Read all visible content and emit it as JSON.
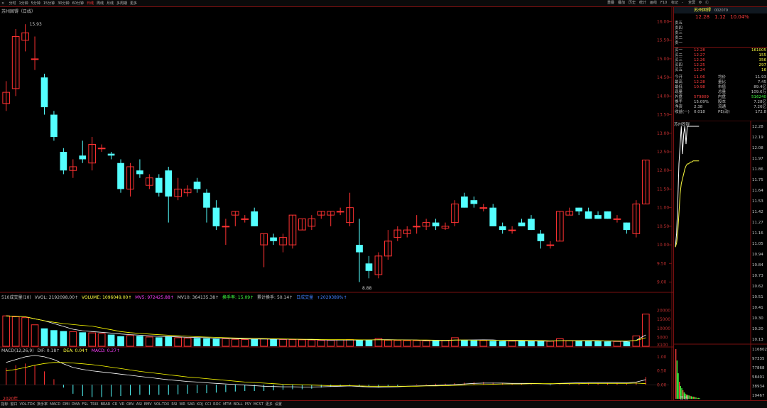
{
  "toolbar": {
    "periods": [
      "分时",
      "1分钟",
      "5分钟",
      "15分钟",
      "30分钟",
      "60分钟",
      "日线",
      "周线",
      "月线",
      "多周期",
      "更多"
    ],
    "active_index": 6,
    "right_items": [
      "重叠",
      "叠加",
      "历史",
      "统计",
      "画线",
      "F10",
      "标记",
      "-",
      "全屏",
      "Φ",
      "Ⓒ"
    ]
  },
  "stock": {
    "name": "苏州固锝",
    "code": "002079",
    "chart_title": "苏州固锝（日线）",
    "price": "12.28",
    "change": "1.12",
    "change_pct": "10.04%"
  },
  "colors": {
    "up": "#ff3232",
    "down": "#54ffff",
    "ma_white": "#ffffff",
    "ma_yellow": "#ffff00",
    "ma_magenta": "#ff40ff",
    "ma_green": "#00ff00",
    "grid_red": "#7a1010"
  },
  "icons": {
    "close_window": "close-icon",
    "refresh": "refresh-icon"
  },
  "chart_data": [
    {
      "type": "candlestick",
      "title": "苏州固锝（日线）",
      "ylim": [
        8.8,
        16.2
      ],
      "y_ticks": [
        "16.00",
        "15.50",
        "15.00",
        "14.50",
        "14.00",
        "13.50",
        "13.00",
        "12.50",
        "12.00",
        "11.50",
        "11.00",
        "10.50",
        "10.00",
        "9.50",
        "9.00"
      ],
      "annotations": {
        "high": "15.93",
        "low": "8.88"
      },
      "candles": [
        {
          "o": 13.8,
          "h": 14.4,
          "l": 13.6,
          "c": 14.1
        },
        {
          "o": 14.2,
          "h": 15.8,
          "l": 14.0,
          "c": 15.6
        },
        {
          "o": 15.5,
          "h": 15.93,
          "l": 15.2,
          "c": 15.7
        },
        {
          "o": 15.0,
          "h": 15.6,
          "l": 14.7,
          "c": 15.0
        },
        {
          "o": 14.5,
          "h": 14.6,
          "l": 13.5,
          "c": 13.7
        },
        {
          "o": 13.5,
          "h": 13.6,
          "l": 12.8,
          "c": 12.9
        },
        {
          "o": 12.5,
          "h": 12.6,
          "l": 11.9,
          "c": 12.0
        },
        {
          "o": 12.0,
          "h": 12.3,
          "l": 11.8,
          "c": 12.1
        },
        {
          "o": 12.4,
          "h": 12.8,
          "l": 12.2,
          "c": 12.3
        },
        {
          "o": 12.2,
          "h": 12.9,
          "l": 12.0,
          "c": 12.7
        },
        {
          "o": 12.6,
          "h": 12.7,
          "l": 12.5,
          "c": 12.6
        },
        {
          "o": 12.45,
          "h": 12.5,
          "l": 12.3,
          "c": 12.4
        },
        {
          "o": 12.2,
          "h": 12.3,
          "l": 11.4,
          "c": 11.5
        },
        {
          "o": 11.5,
          "h": 12.2,
          "l": 11.3,
          "c": 12.1
        },
        {
          "o": 12.0,
          "h": 12.3,
          "l": 11.8,
          "c": 11.9
        },
        {
          "o": 11.6,
          "h": 11.9,
          "l": 11.5,
          "c": 11.8
        },
        {
          "o": 11.8,
          "h": 11.9,
          "l": 11.3,
          "c": 11.4
        },
        {
          "o": 12.0,
          "h": 12.1,
          "l": 10.6,
          "c": 11.3
        },
        {
          "o": 11.3,
          "h": 11.8,
          "l": 11.2,
          "c": 11.5
        },
        {
          "o": 11.4,
          "h": 11.6,
          "l": 11.3,
          "c": 11.5
        },
        {
          "o": 11.7,
          "h": 11.8,
          "l": 11.4,
          "c": 11.5
        },
        {
          "o": 11.4,
          "h": 11.5,
          "l": 10.6,
          "c": 11.0
        },
        {
          "o": 11.0,
          "h": 11.2,
          "l": 10.4,
          "c": 10.5
        },
        {
          "o": 10.5,
          "h": 10.7,
          "l": 10.0,
          "c": 10.5
        },
        {
          "o": 10.8,
          "h": 10.9,
          "l": 10.5,
          "c": 10.9
        },
        {
          "o": 10.7,
          "h": 10.8,
          "l": 10.6,
          "c": 10.7
        },
        {
          "o": 10.9,
          "h": 11.0,
          "l": 10.5,
          "c": 10.5
        },
        {
          "o": 10.0,
          "h": 10.3,
          "l": 9.4,
          "c": 10.3
        },
        {
          "o": 10.2,
          "h": 10.3,
          "l": 10.0,
          "c": 10.1
        },
        {
          "o": 10.0,
          "h": 10.3,
          "l": 9.8,
          "c": 10.2
        },
        {
          "o": 10.0,
          "h": 10.8,
          "l": 9.9,
          "c": 10.8
        },
        {
          "o": 10.4,
          "h": 10.7,
          "l": 10.4,
          "c": 10.7
        },
        {
          "o": 10.5,
          "h": 10.8,
          "l": 10.4,
          "c": 10.7
        },
        {
          "o": 10.8,
          "h": 10.9,
          "l": 10.7,
          "c": 10.9
        },
        {
          "o": 10.8,
          "h": 10.9,
          "l": 10.5,
          "c": 10.9
        },
        {
          "o": 10.9,
          "h": 11.0,
          "l": 10.8,
          "c": 10.9
        },
        {
          "o": 10.6,
          "h": 11.4,
          "l": 10.5,
          "c": 11.0
        },
        {
          "o": 10.0,
          "h": 10.7,
          "l": 9.0,
          "c": 9.8
        },
        {
          "o": 9.5,
          "h": 9.7,
          "l": 9.1,
          "c": 9.3
        },
        {
          "o": 9.2,
          "h": 9.8,
          "l": 9.1,
          "c": 9.7
        },
        {
          "o": 9.7,
          "h": 10.4,
          "l": 9.6,
          "c": 10.1
        },
        {
          "o": 10.2,
          "h": 10.5,
          "l": 10.1,
          "c": 10.4
        },
        {
          "o": 10.3,
          "h": 10.5,
          "l": 10.2,
          "c": 10.4
        },
        {
          "o": 10.5,
          "h": 10.8,
          "l": 10.3,
          "c": 10.5
        },
        {
          "o": 10.5,
          "h": 10.7,
          "l": 10.4,
          "c": 10.6
        },
        {
          "o": 10.6,
          "h": 10.7,
          "l": 10.4,
          "c": 10.5
        },
        {
          "o": 10.45,
          "h": 10.6,
          "l": 10.4,
          "c": 10.5
        },
        {
          "o": 10.6,
          "h": 11.2,
          "l": 10.5,
          "c": 11.1
        },
        {
          "o": 11.3,
          "h": 11.4,
          "l": 11.0,
          "c": 11.0
        },
        {
          "o": 11.2,
          "h": 11.3,
          "l": 11.0,
          "c": 11.1
        },
        {
          "o": 11.0,
          "h": 11.1,
          "l": 10.9,
          "c": 11.0
        },
        {
          "o": 11.0,
          "h": 11.1,
          "l": 10.5,
          "c": 10.5
        },
        {
          "o": 10.5,
          "h": 10.6,
          "l": 10.3,
          "c": 10.4
        },
        {
          "o": 10.4,
          "h": 10.5,
          "l": 10.3,
          "c": 10.4
        },
        {
          "o": 10.6,
          "h": 10.7,
          "l": 10.5,
          "c": 10.5
        },
        {
          "o": 10.7,
          "h": 10.8,
          "l": 10.4,
          "c": 10.4
        },
        {
          "o": 10.3,
          "h": 10.4,
          "l": 9.9,
          "c": 10.1
        },
        {
          "o": 10.0,
          "h": 10.1,
          "l": 9.9,
          "c": 10.0
        },
        {
          "o": 10.1,
          "h": 10.9,
          "l": 10.1,
          "c": 10.9
        },
        {
          "o": 10.8,
          "h": 11.0,
          "l": 10.8,
          "c": 10.9
        },
        {
          "o": 11.0,
          "h": 11.0,
          "l": 10.8,
          "c": 10.9
        },
        {
          "o": 10.9,
          "h": 11.0,
          "l": 10.7,
          "c": 10.7
        },
        {
          "o": 10.8,
          "h": 10.9,
          "l": 10.7,
          "c": 10.7
        },
        {
          "o": 10.9,
          "h": 10.9,
          "l": 10.7,
          "c": 10.7
        },
        {
          "o": 10.7,
          "h": 10.8,
          "l": 10.6,
          "c": 10.7
        },
        {
          "o": 10.6,
          "h": 10.6,
          "l": 10.3,
          "c": 10.4
        },
        {
          "o": 10.3,
          "h": 11.2,
          "l": 10.2,
          "c": 11.1
        },
        {
          "o": 11.1,
          "h": 12.28,
          "l": 11.1,
          "c": 12.28
        }
      ]
    },
    {
      "type": "bar",
      "title": "成交量",
      "values": [
        17000,
        16500,
        16000,
        12000,
        10000,
        9000,
        8500,
        8200,
        7800,
        7500,
        7000,
        6500,
        5600,
        6000,
        5800,
        5200,
        5000,
        5400,
        4800,
        4600,
        4600,
        4400,
        4200,
        4200,
        3900,
        3800,
        4000,
        4200,
        4000,
        3800,
        3700,
        3600,
        3500,
        3300,
        3400,
        3600,
        3700,
        3500,
        3600,
        4300,
        3400,
        3300,
        3200,
        3200,
        3000,
        3100,
        3200,
        4800,
        3500,
        3300,
        3200,
        3000,
        2900,
        2900,
        3000,
        2900,
        2800,
        2800,
        4200,
        3100,
        3000,
        2900,
        2800,
        2700,
        2700,
        2600,
        5800,
        18000
      ],
      "ylim": [
        0,
        25000
      ],
      "y_ticks": [
        "20000",
        "15000",
        "10000",
        "5000",
        "X100"
      ]
    },
    {
      "type": "line",
      "title": "MACD",
      "ylim": [
        -0.5,
        1.2
      ],
      "y_ticks": [
        "1.00",
        "0.50",
        "0.00"
      ],
      "series": [
        {
          "name": "DIF",
          "values": [
            0.8,
            0.9,
            1.0,
            1.05,
            1.0,
            0.9,
            0.75,
            0.62,
            0.55,
            0.5,
            0.46,
            0.42,
            0.38,
            0.34,
            0.3,
            0.26,
            0.22,
            0.18,
            0.15,
            0.12,
            0.1,
            0.07,
            0.05,
            0.03,
            0.01,
            -0.01,
            -0.03,
            -0.05,
            -0.06,
            -0.07,
            -0.07,
            -0.08,
            -0.08,
            -0.07,
            -0.06,
            -0.05,
            -0.04,
            -0.06,
            -0.08,
            -0.09,
            -0.08,
            -0.07,
            -0.05,
            -0.04,
            -0.03,
            -0.02,
            -0.01,
            0.01,
            0.03,
            0.05,
            0.06,
            0.06,
            0.06,
            0.05,
            0.05,
            0.05,
            0.04,
            0.03,
            0.05,
            0.06,
            0.07,
            0.08,
            0.08,
            0.08,
            0.08,
            0.07,
            0.1,
            0.18
          ]
        },
        {
          "name": "DEA",
          "values": [
            0.5,
            0.55,
            0.62,
            0.7,
            0.76,
            0.8,
            0.8,
            0.78,
            0.75,
            0.72,
            0.68,
            0.63,
            0.58,
            0.53,
            0.48,
            0.44,
            0.4,
            0.36,
            0.32,
            0.28,
            0.25,
            0.22,
            0.19,
            0.16,
            0.13,
            0.1,
            0.08,
            0.06,
            0.04,
            0.02,
            0.01,
            0.0,
            -0.01,
            -0.02,
            -0.03,
            -0.03,
            -0.03,
            -0.04,
            -0.05,
            -0.05,
            -0.05,
            -0.05,
            -0.05,
            -0.05,
            -0.04,
            -0.04,
            -0.03,
            -0.02,
            -0.01,
            0.0,
            0.01,
            0.02,
            0.03,
            0.03,
            0.03,
            0.04,
            0.04,
            0.04,
            0.04,
            0.04,
            0.04,
            0.05,
            0.05,
            0.05,
            0.05,
            0.05,
            0.06,
            0.04
          ]
        }
      ]
    }
  ],
  "ma_labels": {
    "ma_title": "",
    "vol_label": "510成交量(10)",
    "vvol": "VVOL: 2192098.00↑",
    "volume": "VOLUME: 1096049.00↑",
    "mv5": "MV5: 972425.88↑",
    "mv10": "MV10: 364135.38↑",
    "turnover": "换手率: 15.09↑",
    "cum_turnover": "累计换手: 50.14↑",
    "extra": "日成交量",
    "extra2": "+2029389%↑",
    "macd_label": "MACD(12,26,9)",
    "dif": "DIF: 0.18↑",
    "dea": "DEA: 0.04↑",
    "macd": "MACD: 0.27↑",
    "year_label": "2020年"
  },
  "orderbook": {
    "sells": [
      {
        "label": "卖五",
        "price": "",
        "vol": ""
      },
      {
        "label": "卖四",
        "price": "",
        "vol": ""
      },
      {
        "label": "卖三",
        "price": "",
        "vol": ""
      },
      {
        "label": "卖二",
        "price": "",
        "vol": ""
      },
      {
        "label": "卖一",
        "price": "",
        "vol": ""
      }
    ],
    "buys": [
      {
        "label": "买一",
        "price": "12.28",
        "vol": "161005"
      },
      {
        "label": "买二",
        "price": "12.27",
        "vol": "155"
      },
      {
        "label": "买三",
        "price": "12.26",
        "vol": "356"
      },
      {
        "label": "买四",
        "price": "12.25",
        "vol": "297"
      },
      {
        "label": "买五",
        "price": "12.24",
        "vol": "16"
      }
    ]
  },
  "stats": [
    {
      "k1": "今开",
      "v1": "11.06",
      "k2": "均价",
      "v2": "11.93"
    },
    {
      "k1": "最高",
      "v1": "12.28",
      "k2": "量比",
      "v2": "7.45"
    },
    {
      "k1": "最低",
      "v1": "10.98",
      "k2": "市值",
      "v2": "89.4亿"
    },
    {
      "k1": "现量",
      "v1": "",
      "k2": "总量",
      "v2": "109.6万"
    },
    {
      "k1": "外盘",
      "v1": "579809",
      "k2": "内盘",
      "v2": "516240"
    },
    {
      "k1": "换手",
      "v1": "15.09%",
      "k2": "股本",
      "v2": "7.28亿"
    },
    {
      "k1": "净资",
      "v1": "2.38",
      "k2": "流通",
      "v2": "7.26亿"
    },
    {
      "k1": "收益(一)",
      "v1": "0.018",
      "k2": "PE(动)",
      "v2": "172.8"
    }
  ],
  "mini_chart": {
    "name": "苏州固锝",
    "price_ticks": [
      "12.28",
      "12.19",
      "12.08",
      "11.97",
      "11.86",
      "11.75",
      "11.64",
      "11.53",
      "11.42",
      "11.27",
      "11.16",
      "11.05",
      "10.94",
      "10.84",
      "10.73",
      "10.62",
      "10.51",
      "10.41",
      "10.30",
      "10.20",
      "10.13"
    ],
    "vol_ticks": [
      "116802",
      "97335",
      "77868",
      "58401",
      "38934",
      "19467"
    ],
    "bottom_label": "日线",
    "price_line": [
      11.06,
      11.2,
      11.5,
      11.9,
      12.1,
      12.28,
      12.0,
      12.2,
      12.28,
      12.1,
      12.28,
      12.28,
      12.28,
      12.28,
      12.28,
      12.28,
      12.28,
      12.28,
      12.28,
      12.28,
      12.28
    ],
    "avg_line": [
      11.06,
      11.1,
      11.2,
      11.4,
      11.6,
      11.7,
      11.75,
      11.8,
      11.85,
      11.88,
      11.9,
      11.9,
      11.91,
      11.92,
      11.92,
      11.93,
      11.93,
      11.93,
      11.93,
      11.93,
      11.93
    ],
    "volume": [
      116802,
      90000,
      60000,
      40000,
      30000,
      25000,
      20000,
      15000,
      12000,
      10000,
      9000,
      8000,
      7000,
      6000,
      5000,
      5000,
      4000,
      3000,
      2000,
      2000,
      1500
    ]
  },
  "bottom_tabs": [
    "指标",
    "窗口",
    "VOL-TDX",
    "换手率",
    "MACD",
    "DMI",
    "DMA",
    "FSL",
    "TRIX",
    "BRAR",
    "CR",
    "VR",
    "OBV",
    "ASI",
    "EMV",
    "VOL-TDX",
    "RSI",
    "WR",
    "SAR",
    "KDJ",
    "CCI",
    "ROC",
    "MTM",
    "BOLL",
    "PSY",
    "MCST",
    "更多",
    "设置"
  ]
}
